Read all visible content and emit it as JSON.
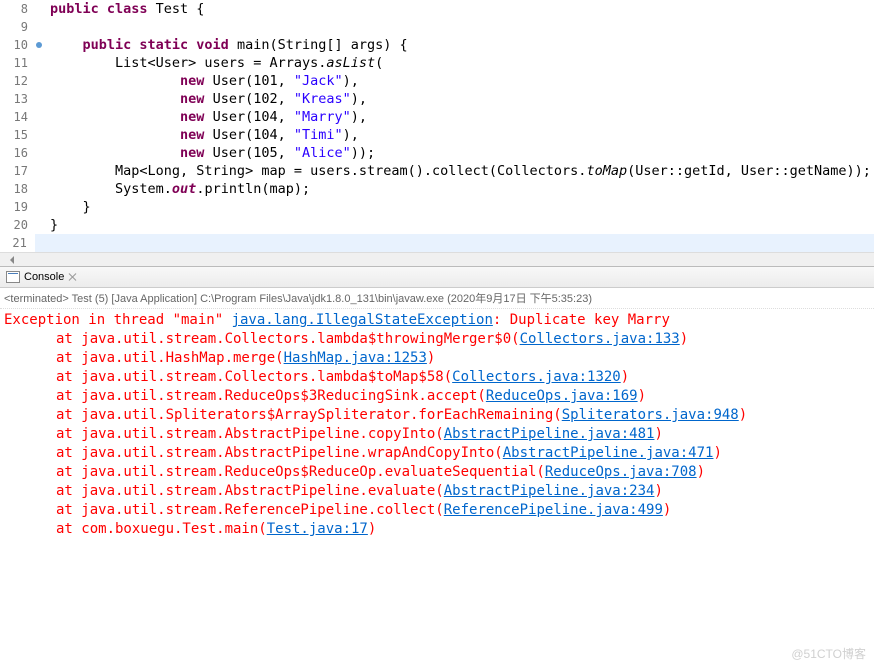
{
  "editor": {
    "lines": [
      {
        "n": "8",
        "segs": [
          {
            "t": "public class ",
            "c": "kw"
          },
          {
            "t": "Test {",
            "c": "plain"
          }
        ]
      },
      {
        "n": "9",
        "segs": []
      },
      {
        "n": "10",
        "marker": true,
        "segs": [
          {
            "t": "    ",
            "c": "plain"
          },
          {
            "t": "public static void ",
            "c": "kw"
          },
          {
            "t": "main(String[] args) {",
            "c": "plain"
          }
        ]
      },
      {
        "n": "11",
        "segs": [
          {
            "t": "        List<User> users = Arrays.",
            "c": "plain"
          },
          {
            "t": "asList",
            "c": "italic"
          },
          {
            "t": "(",
            "c": "plain"
          }
        ]
      },
      {
        "n": "12",
        "segs": [
          {
            "t": "                ",
            "c": "plain"
          },
          {
            "t": "new ",
            "c": "kw"
          },
          {
            "t": "User(101, ",
            "c": "plain"
          },
          {
            "t": "\"Jack\"",
            "c": "str"
          },
          {
            "t": "),",
            "c": "plain"
          }
        ]
      },
      {
        "n": "13",
        "segs": [
          {
            "t": "                ",
            "c": "plain"
          },
          {
            "t": "new ",
            "c": "kw"
          },
          {
            "t": "User(102, ",
            "c": "plain"
          },
          {
            "t": "\"Kreas\"",
            "c": "str"
          },
          {
            "t": "),",
            "c": "plain"
          }
        ]
      },
      {
        "n": "14",
        "segs": [
          {
            "t": "                ",
            "c": "plain"
          },
          {
            "t": "new ",
            "c": "kw"
          },
          {
            "t": "User(104, ",
            "c": "plain"
          },
          {
            "t": "\"Marry\"",
            "c": "str"
          },
          {
            "t": "),",
            "c": "plain"
          }
        ]
      },
      {
        "n": "15",
        "segs": [
          {
            "t": "                ",
            "c": "plain"
          },
          {
            "t": "new ",
            "c": "kw"
          },
          {
            "t": "User(104, ",
            "c": "plain"
          },
          {
            "t": "\"Timi\"",
            "c": "str"
          },
          {
            "t": "),",
            "c": "plain"
          }
        ]
      },
      {
        "n": "16",
        "segs": [
          {
            "t": "                ",
            "c": "plain"
          },
          {
            "t": "new ",
            "c": "kw"
          },
          {
            "t": "User(105, ",
            "c": "plain"
          },
          {
            "t": "\"Alice\"",
            "c": "str"
          },
          {
            "t": "));",
            "c": "plain"
          }
        ]
      },
      {
        "n": "17",
        "segs": [
          {
            "t": "        Map<Long, String> map = users.stream().collect(Collectors.",
            "c": "plain"
          },
          {
            "t": "toMap",
            "c": "italic"
          },
          {
            "t": "(User::getId, User::getName));",
            "c": "plain"
          }
        ]
      },
      {
        "n": "18",
        "segs": [
          {
            "t": "        System.",
            "c": "plain"
          },
          {
            "t": "out",
            "c": "kw italic"
          },
          {
            "t": ".println(map);",
            "c": "plain"
          }
        ]
      },
      {
        "n": "19",
        "segs": [
          {
            "t": "    }",
            "c": "plain"
          }
        ]
      },
      {
        "n": "20",
        "segs": [
          {
            "t": "}",
            "c": "plain"
          }
        ]
      },
      {
        "n": "21",
        "cursor": true,
        "segs": [
          {
            "t": "",
            "c": "plain"
          }
        ]
      }
    ]
  },
  "console": {
    "tab": "Console",
    "terminated": "<terminated> Test (5) [Java Application] C:\\Program Files\\Java\\jdk1.8.0_131\\bin\\javaw.exe (2020年9月17日 下午5:35:23)",
    "lines": [
      {
        "indent": 0,
        "pre": "Exception in thread \"main\" ",
        "link": "java.lang.IllegalStateException",
        "post": ": Duplicate key Marry"
      },
      {
        "indent": 1,
        "pre": "at java.util.stream.Collectors.lambda$throwingMerger$0(",
        "link": "Collectors.java:133",
        "post": ")"
      },
      {
        "indent": 1,
        "pre": "at java.util.HashMap.merge(",
        "link": "HashMap.java:1253",
        "post": ")"
      },
      {
        "indent": 1,
        "pre": "at java.util.stream.Collectors.lambda$toMap$58(",
        "link": "Collectors.java:1320",
        "post": ")"
      },
      {
        "indent": 1,
        "pre": "at java.util.stream.ReduceOps$3ReducingSink.accept(",
        "link": "ReduceOps.java:169",
        "post": ")"
      },
      {
        "indent": 1,
        "pre": "at java.util.Spliterators$ArraySpliterator.forEachRemaining(",
        "link": "Spliterators.java:948",
        "post": ")"
      },
      {
        "indent": 1,
        "pre": "at java.util.stream.AbstractPipeline.copyInto(",
        "link": "AbstractPipeline.java:481",
        "post": ")"
      },
      {
        "indent": 1,
        "pre": "at java.util.stream.AbstractPipeline.wrapAndCopyInto(",
        "link": "AbstractPipeline.java:471",
        "post": ")"
      },
      {
        "indent": 1,
        "pre": "at java.util.stream.ReduceOps$ReduceOp.evaluateSequential(",
        "link": "ReduceOps.java:708",
        "post": ")"
      },
      {
        "indent": 1,
        "pre": "at java.util.stream.AbstractPipeline.evaluate(",
        "link": "AbstractPipeline.java:234",
        "post": ")"
      },
      {
        "indent": 1,
        "pre": "at java.util.stream.ReferencePipeline.collect(",
        "link": "ReferencePipeline.java:499",
        "post": ")"
      },
      {
        "indent": 1,
        "pre": "at com.boxuegu.Test.main(",
        "link": "Test.java:17",
        "post": ")"
      }
    ]
  },
  "watermark": "@51CTO博客"
}
